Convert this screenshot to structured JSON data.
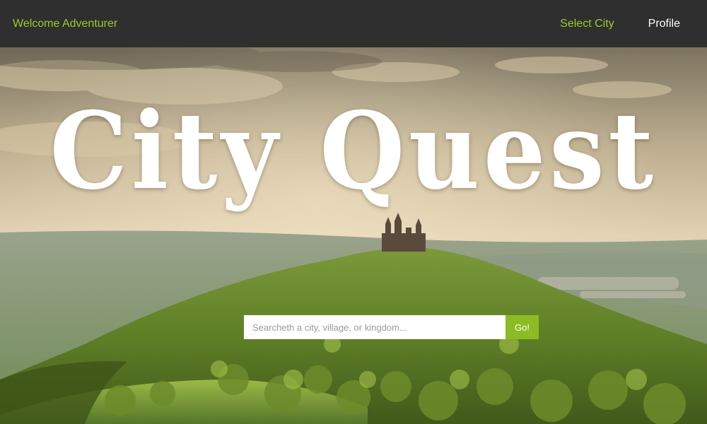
{
  "navbar": {
    "brand": "Welcome Adventurer",
    "select_city": "Select City",
    "profile": "Profile"
  },
  "hero": {
    "title": "City Quest",
    "search": {
      "placeholder": "Searcheth a city, village, or kingdom...",
      "value": "",
      "button_label": "Go!"
    }
  },
  "colors": {
    "accent": "#9ccb2b",
    "button": "#8dbb24",
    "navbar_bg": "#2f2f2f"
  }
}
